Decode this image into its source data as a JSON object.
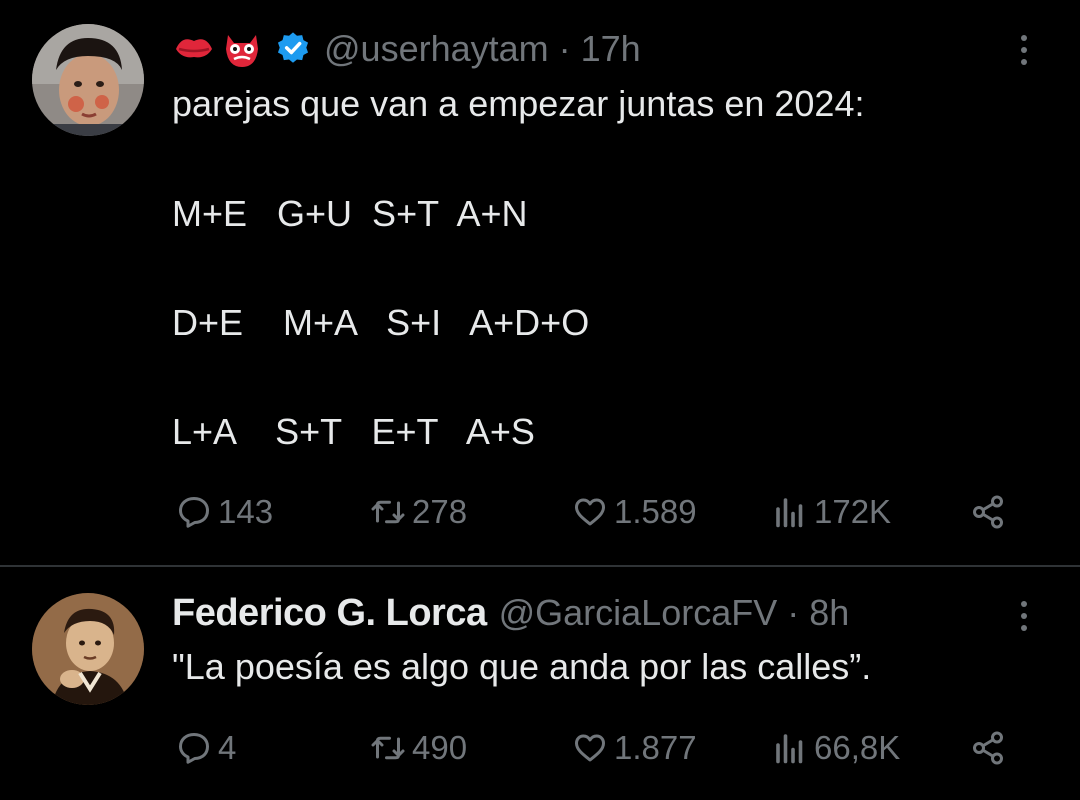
{
  "tweets": [
    {
      "author": {
        "name_emojis": [
          "kiss-mark",
          "goblin-mask"
        ],
        "verified": true,
        "handle": "@userhaytam",
        "separator": "·",
        "time": "17h"
      },
      "text_lines": [
        "parejas que van a empezar juntas en 2024:",
        "M+E   G+U  S+T  A+N",
        "D+E    M+A   S+I   A+D+O",
        "L+A    S+T   E+T   A+S"
      ],
      "stats": {
        "replies": "143",
        "retweets": "278",
        "likes": "1.589",
        "views": "172K"
      }
    },
    {
      "author": {
        "display_name": "Federico G. Lorca",
        "handle": "@GarciaLorcaFV",
        "separator": "·",
        "time": "8h"
      },
      "text_lines": [
        "\"La poesía es algo que anda por las calles”."
      ],
      "stats": {
        "replies": "4",
        "retweets": "490",
        "likes": "1.877",
        "views": "66,8K"
      }
    }
  ],
  "colors": {
    "background": "#000000",
    "text": "#e7e9ea",
    "muted": "#71767b",
    "verified": "#1d9bf0",
    "divider": "#2f3336"
  },
  "icons": [
    "reply-icon",
    "retweet-icon",
    "like-icon",
    "views-icon",
    "share-icon",
    "more-icon",
    "verified-badge-icon"
  ]
}
